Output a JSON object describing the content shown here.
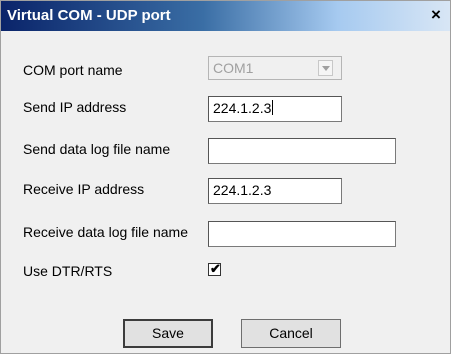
{
  "window": {
    "title": "Virtual COM - UDP port",
    "close_label": "×"
  },
  "form": {
    "com_port_label": "COM port name",
    "com_port_value": "COM1",
    "send_ip_label": "Send IP address",
    "send_ip_value": "224.1.2.3",
    "send_log_label": "Send data log file name",
    "send_log_value": "",
    "receive_ip_label": "Receive IP address",
    "receive_ip_value": "224.1.2.3",
    "receive_log_label": "Receive data log file name",
    "receive_log_value": "",
    "dtr_label": "Use DTR/RTS",
    "dtr_checked": true
  },
  "buttons": {
    "save": "Save",
    "cancel": "Cancel"
  },
  "colors": {
    "title_start": "#0a246a",
    "title_end": "#d8e6f5",
    "dialog_bg": "#f0f0f0"
  }
}
